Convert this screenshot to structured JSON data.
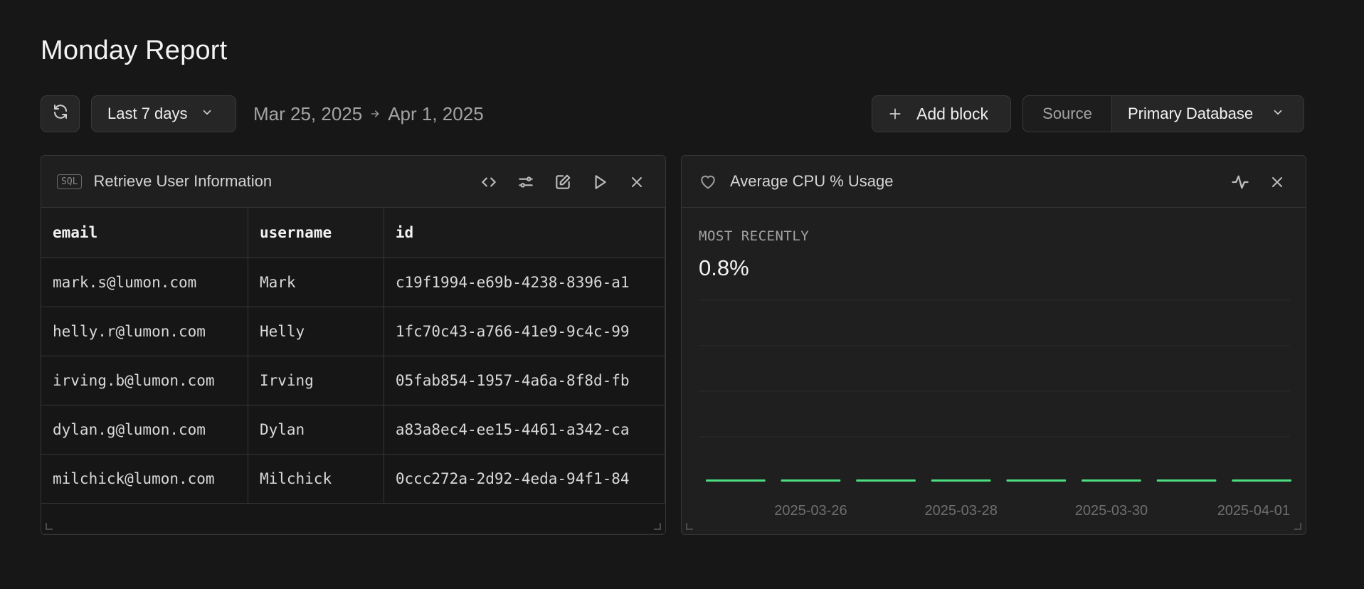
{
  "page": {
    "title": "Monday Report"
  },
  "toolbar": {
    "range_label": "Last 7 days",
    "date_from": "Mar 25, 2025",
    "date_to": "Apr 1, 2025",
    "add_block_label": "Add block",
    "source_label": "Source",
    "source_value": "Primary Database"
  },
  "sql_block": {
    "badge": "SQL",
    "title": "Retrieve User Information",
    "columns": [
      "email",
      "username",
      "id"
    ],
    "rows": [
      [
        "mark.s@lumon.com",
        "Mark",
        "c19f1994-e69b-4238-8396-a1"
      ],
      [
        "helly.r@lumon.com",
        "Helly",
        "1fc70c43-a766-41e9-9c4c-99"
      ],
      [
        "irving.b@lumon.com",
        "Irving",
        "05fab854-1957-4a6a-8f8d-fb"
      ],
      [
        "dylan.g@lumon.com",
        "Dylan",
        "a83a8ec4-ee15-4461-a342-ca"
      ],
      [
        "milchick@lumon.com",
        "Milchick",
        "0ccc272a-2d92-4eda-94f1-84"
      ]
    ]
  },
  "cpu_block": {
    "title": "Average CPU % Usage",
    "metric_label": "MOST RECENTLY",
    "metric_value": "0.8%"
  },
  "chart_data": {
    "type": "bar",
    "title": "Average CPU % Usage",
    "categories": [
      "2025-03-25",
      "2025-03-26",
      "2025-03-27",
      "2025-03-28",
      "2025-03-29",
      "2025-03-30",
      "2025-03-31",
      "2025-04-01"
    ],
    "tick_labels": [
      "2025-03-26",
      "2025-03-28",
      "2025-03-30",
      "2025-04-01"
    ],
    "values": [
      0.8,
      0.8,
      0.8,
      0.8,
      0.8,
      0.8,
      0.8,
      0.8
    ],
    "ylim": [
      0,
      100
    ],
    "grid": true,
    "color": "#4ade80"
  },
  "colors": {
    "background": "#171717",
    "panel": "#1f1f1f",
    "accent": "#4ade80"
  }
}
